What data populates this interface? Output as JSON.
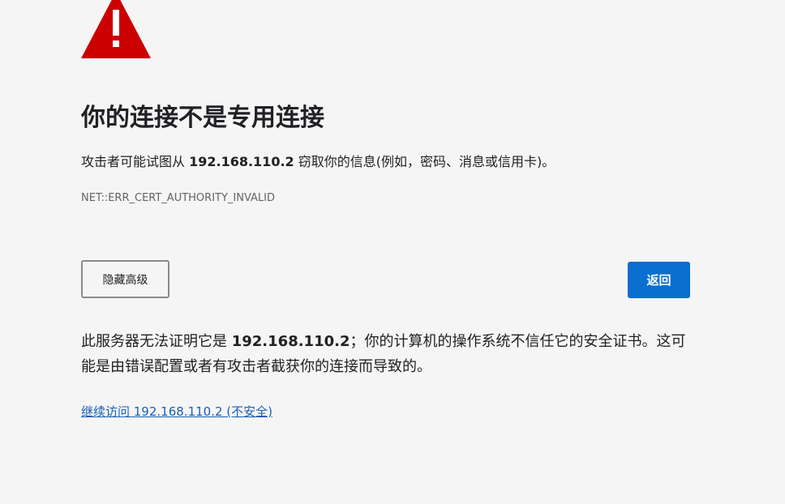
{
  "icon": {
    "name": "warning-triangle-icon",
    "color": "#cc0000",
    "glyph_color": "#ffffff"
  },
  "error": {
    "title": "你的连接不是专用连接",
    "desc_prefix": "攻击者可能试图从 ",
    "host": "192.168.110.2",
    "desc_suffix": " 窃取你的信息(例如，密码、消息或信用卡)。",
    "code": "NET::ERR_CERT_AUTHORITY_INVALID"
  },
  "buttons": {
    "hide_advanced": "隐藏高级",
    "back": "返回",
    "back_color": "#0a6fcf"
  },
  "details": {
    "prefix": "此服务器无法证明它是 ",
    "host": "192.168.110.2",
    "suffix": "；你的计算机的操作系统不信任它的安全证书。这可能是由错误配置或者有攻击者截获你的连接而导致的。"
  },
  "proceed": {
    "link_text": "继续访问 192.168.110.2 (不安全)"
  }
}
